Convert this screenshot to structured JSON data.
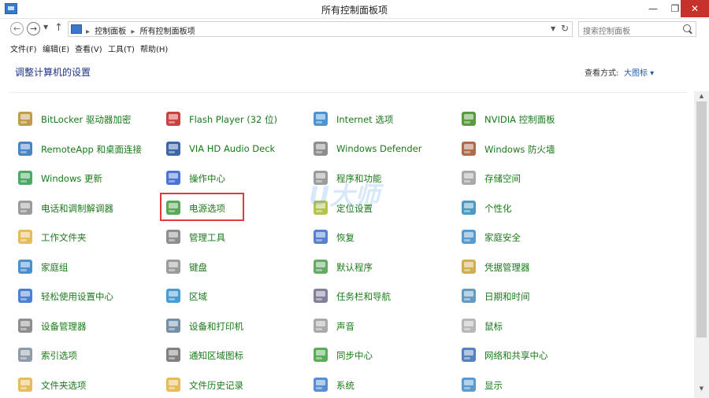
{
  "window": {
    "title": "所有控制面板项",
    "minimize": "—",
    "maximize": "❐",
    "close": "✕"
  },
  "nav": {
    "back": "←",
    "forward": "→",
    "recent": "▼",
    "up": "↑",
    "breadcrumb": [
      "控制面板",
      "所有控制面板项"
    ],
    "separator": "▸",
    "dropdown": "▼",
    "refresh": "↻",
    "search_placeholder": "搜索控制面板"
  },
  "menu": [
    "文件(F)",
    "编辑(E)",
    "查看(V)",
    "工具(T)",
    "帮助(H)"
  ],
  "header": {
    "heading": "调整计算机的设置",
    "view_by_label": "查看方式:",
    "view_by_value": "大图标 ▾"
  },
  "watermark": "U大师",
  "items": [
    {
      "label": "BitLocker 驱动器加密",
      "icon": "bitlocker-icon",
      "color": "#b58a2b"
    },
    {
      "label": "Flash Player (32 位)",
      "icon": "flash-icon",
      "color": "#c0211c"
    },
    {
      "label": "Internet 选项",
      "icon": "globe-icon",
      "color": "#2a82c9"
    },
    {
      "label": "NVIDIA 控制面板",
      "icon": "nvidia-icon",
      "color": "#3c8b1c"
    },
    {
      "label": "RemoteApp 和桌面连接",
      "icon": "remoteapp-icon",
      "color": "#2a6fb8"
    },
    {
      "label": "VIA HD Audio Deck",
      "icon": "via-icon",
      "color": "#1b4b97"
    },
    {
      "label": "Windows Defender",
      "icon": "castle-icon",
      "color": "#7a7a7a"
    },
    {
      "label": "Windows 防火墙",
      "icon": "firewall-icon",
      "color": "#a0522d"
    },
    {
      "label": "Windows 更新",
      "icon": "update-icon",
      "color": "#2a9a4a"
    },
    {
      "label": "操作中心",
      "icon": "flag-icon",
      "color": "#2a5cc9"
    },
    {
      "label": "程序和功能",
      "icon": "programs-icon",
      "color": "#8a8a8a"
    },
    {
      "label": "存储空间",
      "icon": "storage-icon",
      "color": "#9a9a9a"
    },
    {
      "label": "电话和调制解调器",
      "icon": "phone-icon",
      "color": "#8a8a8a"
    },
    {
      "label": "电源选项",
      "icon": "battery-icon",
      "color": "#3a9a3a"
    },
    {
      "label": "定位设置",
      "icon": "location-icon",
      "color": "#a8b82a"
    },
    {
      "label": "个性化",
      "icon": "personalize-icon",
      "color": "#2a8ab8"
    },
    {
      "label": "工作文件夹",
      "icon": "folder-icon",
      "color": "#e0b040"
    },
    {
      "label": "管理工具",
      "icon": "admin-tools-icon",
      "color": "#7a7a7a"
    },
    {
      "label": "恢复",
      "icon": "recovery-icon",
      "color": "#3a6ac9"
    },
    {
      "label": "家庭安全",
      "icon": "family-icon",
      "color": "#3a8ac9"
    },
    {
      "label": "家庭组",
      "icon": "homegroup-icon",
      "color": "#2a7ac9"
    },
    {
      "label": "键盘",
      "icon": "keyboard-icon",
      "color": "#8a8a8a"
    },
    {
      "label": "默认程序",
      "icon": "default-programs-icon",
      "color": "#4a9a4a"
    },
    {
      "label": "凭据管理器",
      "icon": "credential-icon",
      "color": "#c9a030"
    },
    {
      "label": "轻松使用设置中心",
      "icon": "ease-access-icon",
      "color": "#2a6ac9"
    },
    {
      "label": "区域",
      "icon": "region-icon",
      "color": "#2a8ac9"
    },
    {
      "label": "任务栏和导航",
      "icon": "taskbar-icon",
      "color": "#6a6a8a"
    },
    {
      "label": "日期和时间",
      "icon": "clock-icon",
      "color": "#4a8ab8"
    },
    {
      "label": "设备管理器",
      "icon": "device-manager-icon",
      "color": "#7a7a7a"
    },
    {
      "label": "设备和打印机",
      "icon": "printer-icon",
      "color": "#5a7a9a"
    },
    {
      "label": "声音",
      "icon": "sound-icon",
      "color": "#9a9a9a"
    },
    {
      "label": "鼠标",
      "icon": "mouse-icon",
      "color": "#aaaaaa"
    },
    {
      "label": "索引选项",
      "icon": "index-icon",
      "color": "#7a8a9a"
    },
    {
      "label": "通知区域图标",
      "icon": "notification-icon",
      "color": "#6a6a6a"
    },
    {
      "label": "同步中心",
      "icon": "sync-icon",
      "color": "#3aa03a"
    },
    {
      "label": "网络和共享中心",
      "icon": "network-icon",
      "color": "#3a6ab8"
    },
    {
      "label": "文件夹选项",
      "icon": "folder-options-icon",
      "color": "#e0b040"
    },
    {
      "label": "文件历史记录",
      "icon": "file-history-icon",
      "color": "#e0b040"
    },
    {
      "label": "系统",
      "icon": "system-icon",
      "color": "#3a7ac9"
    },
    {
      "label": "显示",
      "icon": "display-icon",
      "color": "#3a8ac9"
    }
  ]
}
